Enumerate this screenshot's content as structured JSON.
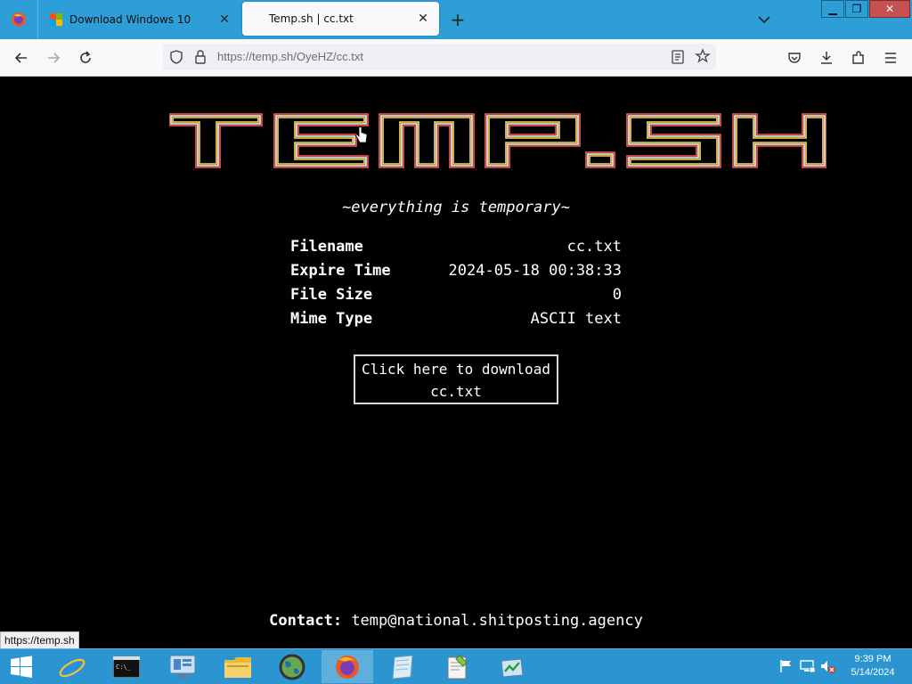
{
  "browser": {
    "tabs": [
      {
        "title": "Download Windows 10",
        "active": false
      },
      {
        "title": "Temp.sh | cc.txt",
        "active": true
      }
    ],
    "url": "https://temp.sh/OyeHZ/cc.txt",
    "status_url": "https://temp.sh"
  },
  "page": {
    "logo_text": "TEMP.SH",
    "tagline": "~everything is temporary~",
    "file_info": [
      {
        "label": "Filename",
        "value": "cc.txt"
      },
      {
        "label": "Expire Time",
        "value": "2024-05-18 00:38:33"
      },
      {
        "label": "File Size",
        "value": "0"
      },
      {
        "label": "Mime Type",
        "value": "ASCII text"
      }
    ],
    "download_line1": "Click here to download",
    "download_line2": "cc.txt",
    "contact_label": "Contact:",
    "contact_email": "temp@national.shitposting.agency"
  },
  "taskbar": {
    "time": "9:39 PM",
    "date": "5/14/2024",
    "apps": [
      "start-icon",
      "internet-explorer-icon",
      "command-prompt-icon",
      "server-manager-icon",
      "file-explorer-icon",
      "network-globe-icon",
      "firefox-icon",
      "notepad-icon",
      "notepad-plus-plus-icon",
      "task-manager-icon"
    ]
  },
  "colors": {
    "tabbar": "#2d9ed6",
    "taskbar": "#2a95d0",
    "page_bg": "#000000"
  }
}
